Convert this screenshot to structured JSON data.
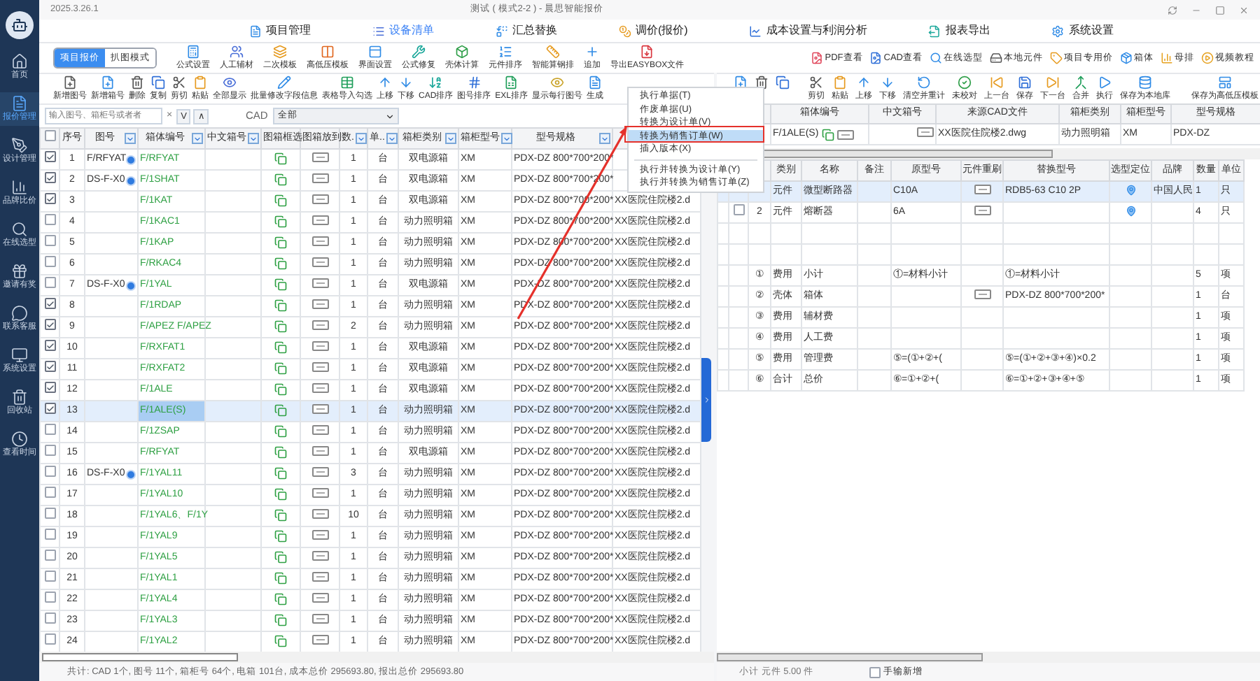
{
  "app": {
    "version": "2025.3.26.1",
    "title": "测试 ( 模式2-2 ) - 晨思智能报价"
  },
  "sidebar": {
    "items": [
      {
        "label": "首页",
        "selected": false
      },
      {
        "label": "报价管理",
        "selected": true
      },
      {
        "label": "设计管理",
        "selected": false
      },
      {
        "label": "品牌比价",
        "selected": false
      },
      {
        "label": "在线选型",
        "selected": false
      },
      {
        "label": "邀请有奖",
        "selected": false
      },
      {
        "label": "联系客服",
        "selected": false
      },
      {
        "label": "系统设置",
        "selected": false
      },
      {
        "label": "回收站",
        "selected": false
      },
      {
        "label": "查看时间",
        "selected": false
      }
    ]
  },
  "main_tabs": [
    {
      "label": "项目管理",
      "selected": false
    },
    {
      "label": "设备清单",
      "selected": true
    },
    {
      "label": "汇总替换",
      "selected": false
    },
    {
      "label": "调价(报价)",
      "selected": false
    },
    {
      "label": "成本设置与利润分析",
      "selected": false
    },
    {
      "label": "报表导出",
      "selected": false
    },
    {
      "label": "系统设置",
      "selected": false
    }
  ],
  "mode_toggle": [
    {
      "label": "项目报价",
      "selected": true
    },
    {
      "label": "扒图模式",
      "selected": false
    }
  ],
  "toolbar_main": [
    "公式设置",
    "人工辅材",
    "二次模板",
    "高低压模板",
    "界面设置",
    "公式修复",
    "壳体计算",
    "元件排序",
    "智能算钢排",
    "追加",
    "导出EASYBOX文件"
  ],
  "toolbar_tools": [
    "PDF查看",
    "CAD查看",
    "在线选型",
    "本地元件",
    "项目专用价",
    "箱体",
    "母排",
    "视频教程"
  ],
  "list_toolbar": [
    "新增图号",
    "新增箱号",
    "删除",
    "复制",
    "剪切",
    "粘贴",
    "全部显示",
    "批量修改字段信息",
    "表格导入勾选",
    "上移",
    "下移",
    "CAD排序",
    "图号排序",
    "EXL排序",
    "显示每行图号",
    "生成"
  ],
  "search": {
    "placeholder": "输入图号、箱柜号或者者",
    "clear": "×",
    "next": "V",
    "prev": "∧",
    "cad_label": "CAD",
    "cad_filter": "全部"
  },
  "list_table": {
    "header_checked": false,
    "columns": [
      {
        "label": "序号",
        "filter": false
      },
      {
        "label": "图号",
        "filter": true
      },
      {
        "label": "箱体编号",
        "filter": true
      },
      {
        "label": "中文箱号",
        "filter": true
      },
      {
        "label": "图箱框选",
        "filter": false
      },
      {
        "label": "图箱放到",
        "filter": false
      },
      {
        "label": "数.",
        "filter": true
      },
      {
        "label": "单..",
        "filter": true
      },
      {
        "label": "箱柜类别",
        "filter": true
      },
      {
        "label": "箱柜型号",
        "filter": true
      },
      {
        "label": "型号规格",
        "filter": true
      }
    ],
    "rows": [
      {
        "checked": true,
        "selected": false,
        "no": "1",
        "drawing": "F/RFYAT",
        "badge": true,
        "box": "F/RFYAT",
        "qty": "1",
        "unit": "台",
        "category": "双电源箱",
        "model": "XM",
        "spec": "PDX-DZ 800*700*200*"
      },
      {
        "checked": true,
        "selected": false,
        "no": "2",
        "drawing": "DS-F-X0",
        "badge": true,
        "box": "F/1SHAT",
        "qty": "1",
        "unit": "台",
        "category": "双电源箱",
        "model": "XM",
        "spec": "PDX-DZ 800*700*200*"
      },
      {
        "checked": true,
        "selected": false,
        "no": "3",
        "box": "F/1KAT",
        "qty": "1",
        "unit": "台",
        "category": "双电源箱",
        "model": "XM",
        "spec": "PDX-DZ 800*700*200*",
        "cad": "XX医院住院楼2.d"
      },
      {
        "checked": false,
        "selected": false,
        "no": "4",
        "box": "F/1KAC1",
        "qty": "1",
        "unit": "台",
        "category": "动力照明箱",
        "model": "XM",
        "spec": "PDX-DZ 800*700*200*",
        "cad": "XX医院住院楼2.d"
      },
      {
        "checked": false,
        "selected": false,
        "no": "5",
        "box": "F/1KAP",
        "qty": "1",
        "unit": "台",
        "category": "动力照明箱",
        "model": "XM",
        "spec": "PDX-DZ 800*700*200*",
        "cad": "XX医院住院楼2.d"
      },
      {
        "checked": false,
        "selected": false,
        "no": "6",
        "box": "F/RKAC4",
        "qty": "1",
        "unit": "台",
        "category": "动力照明箱",
        "model": "XM",
        "spec": "PDX-DZ 800*700*200*",
        "cad": "XX医院住院楼2.d"
      },
      {
        "checked": false,
        "selected": false,
        "no": "7",
        "drawing": "DS-F-X0",
        "badge": true,
        "box": "F/1YAL",
        "qty": "1",
        "unit": "台",
        "category": "双电源箱",
        "model": "XM",
        "spec": "PDX-DZ 800*700*200*",
        "cad": "XX医院住院楼2.d"
      },
      {
        "checked": true,
        "selected": false,
        "no": "8",
        "box": "F/1RDAP",
        "qty": "1",
        "unit": "台",
        "category": "动力照明箱",
        "model": "XM",
        "spec": "PDX-DZ 800*700*200*",
        "cad": "XX医院住院楼2.d"
      },
      {
        "checked": true,
        "selected": false,
        "no": "9",
        "box": "F/APEZ F/APEZ",
        "qty": "2",
        "unit": "台",
        "category": "动力照明箱",
        "model": "XM",
        "spec": "PDX-DZ 800*700*200*",
        "cad": "XX医院住院楼2.d"
      },
      {
        "checked": true,
        "selected": false,
        "no": "10",
        "box": "F/RXFAT1",
        "qty": "1",
        "unit": "台",
        "category": "双电源箱",
        "model": "XM",
        "spec": "PDX-DZ 800*700*200*",
        "cad": "XX医院住院楼2.d"
      },
      {
        "checked": true,
        "selected": false,
        "no": "11",
        "box": "F/RXFAT2",
        "qty": "1",
        "unit": "台",
        "category": "双电源箱",
        "model": "XM",
        "spec": "PDX-DZ 800*700*200*",
        "cad": "XX医院住院楼2.d"
      },
      {
        "checked": true,
        "selected": false,
        "no": "12",
        "box": "F/1ALE",
        "qty": "1",
        "unit": "台",
        "category": "双电源箱",
        "model": "XM",
        "spec": "PDX-DZ 800*700*200*",
        "cad": "XX医院住院楼2.d"
      },
      {
        "checked": true,
        "selected": true,
        "no": "13",
        "box": "F/1ALE(S)",
        "qty": "1",
        "unit": "台",
        "category": "动力照明箱",
        "model": "XM",
        "spec": "PDX-DZ 800*700*200*",
        "cad": "XX医院住院楼2.d"
      },
      {
        "checked": false,
        "selected": false,
        "no": "14",
        "box": "F/1ZSAP",
        "qty": "1",
        "unit": "台",
        "category": "动力照明箱",
        "model": "XM",
        "spec": "PDX-DZ 800*700*200*",
        "cad": "XX医院住院楼2.d"
      },
      {
        "checked": false,
        "selected": false,
        "no": "15",
        "box": "F/RFYAT",
        "qty": "1",
        "unit": "台",
        "category": "双电源箱",
        "model": "XM",
        "spec": "PDX-DZ 800*700*200*",
        "cad": "XX医院住院楼2.d"
      },
      {
        "checked": false,
        "selected": false,
        "no": "16",
        "drawing": "DS-F-X0",
        "badge": true,
        "box": "F/1YAL11",
        "qty": "3",
        "unit": "台",
        "category": "动力照明箱",
        "model": "XM",
        "spec": "PDX-DZ 800*700*200*",
        "cad": "XX医院住院楼2.d"
      },
      {
        "checked": false,
        "selected": false,
        "no": "17",
        "box": "F/1YAL10",
        "qty": "1",
        "unit": "台",
        "category": "动力照明箱",
        "model": "XM",
        "spec": "PDX-DZ 800*700*200*",
        "cad": "XX医院住院楼2.d"
      },
      {
        "checked": false,
        "selected": false,
        "no": "18",
        "box": "F/1YAL6、F/1Y",
        "qty": "10",
        "unit": "台",
        "category": "动力照明箱",
        "model": "XM",
        "spec": "PDX-DZ 800*700*200*",
        "cad": "XX医院住院楼2.d"
      },
      {
        "checked": false,
        "selected": false,
        "no": "19",
        "box": "F/1YAL9",
        "qty": "1",
        "unit": "台",
        "category": "动力照明箱",
        "model": "XM",
        "spec": "PDX-DZ 800*700*200*",
        "cad": "XX医院住院楼2.d"
      },
      {
        "checked": false,
        "selected": false,
        "no": "20",
        "box": "F/1YAL5",
        "qty": "1",
        "unit": "台",
        "category": "动力照明箱",
        "model": "XM",
        "spec": "PDX-DZ 800*700*200*",
        "cad": "XX医院住院楼2.d"
      },
      {
        "checked": false,
        "selected": false,
        "no": "21",
        "box": "F/1YAL1",
        "qty": "1",
        "unit": "台",
        "category": "动力照明箱",
        "model": "XM",
        "spec": "PDX-DZ 800*700*200*",
        "cad": "XX医院住院楼2.d"
      },
      {
        "checked": false,
        "selected": false,
        "no": "22",
        "box": "F/1YAL4",
        "qty": "1",
        "unit": "台",
        "category": "动力照明箱",
        "model": "XM",
        "spec": "PDX-DZ 800*700*200*",
        "cad": "XX医院住院楼2.d"
      },
      {
        "checked": false,
        "selected": false,
        "no": "23",
        "box": "F/1YAL3",
        "qty": "1",
        "unit": "台",
        "category": "动力照明箱",
        "model": "XM",
        "spec": "PDX-DZ 800*700*200*",
        "cad": "XX医院住院楼2.d"
      },
      {
        "checked": false,
        "selected": false,
        "no": "24",
        "box": "F/1YAL2",
        "qty": "1",
        "unit": "台",
        "category": "动力照明箱",
        "model": "XM",
        "spec": "PDX-DZ 800*700*200*",
        "cad": "XX医院住院楼2.d"
      }
    ]
  },
  "list_status": "共计: CAD 1个, 图号 11个, 箱柜号 64个, 电箱 101台, 成本总价 295693.80, 报出总价 295693.80",
  "detail_toolbar": [
    "剪切",
    "粘贴",
    "上移",
    "下移",
    "清空并重计",
    "未校对",
    "上一台",
    "保存",
    "下一台",
    "合并",
    "执行",
    "保存为本地库",
    "保存为高低压模板"
  ],
  "box_header": {
    "columns": [
      "箱体编号",
      "中文箱号",
      "来源CAD文件",
      "箱柜类别",
      "箱柜型号",
      "型号规格"
    ],
    "row": {
      "box": "F/1ALE(S)",
      "cad": "XX医院住院楼2.dwg",
      "category": "动力照明箱",
      "model": "XM",
      "spec": "PDX-DZ"
    }
  },
  "detail_table": {
    "columns": [
      "类别",
      "名称",
      "备注",
      "原型号",
      "元件重刷",
      "替换型号",
      "选型定位",
      "品牌",
      "数量",
      "单位"
    ],
    "rows": [
      {
        "kind": "item",
        "selected": true,
        "category": "元件",
        "name": "微型断路器",
        "orig": "C10A",
        "refresh": true,
        "replace": "RDB5-63 C10 2P",
        "locate": true,
        "brand": "中国人民",
        "qty": "1",
        "unit": "只"
      },
      {
        "kind": "item",
        "selected": false,
        "checked": false,
        "no": "2",
        "category": "元件",
        "name": "熔断器",
        "orig": "6A",
        "refresh": true,
        "locate": true,
        "qty": "4",
        "unit": "只"
      },
      {
        "kind": "blank"
      },
      {
        "kind": "blank"
      },
      {
        "kind": "cost",
        "no": "①",
        "category": "费用",
        "name": "小计",
        "orig": "①=材料小计",
        "replace": "①=材料小计",
        "qty": "5",
        "unit": "项"
      },
      {
        "kind": "cost",
        "no": "②",
        "category": "壳体",
        "name": "箱体",
        "refresh": true,
        "replace": "PDX-DZ 800*700*200*",
        "qty": "1",
        "unit": "台"
      },
      {
        "kind": "cost",
        "no": "③",
        "category": "费用",
        "name": "辅材费",
        "qty": "1",
        "unit": "项"
      },
      {
        "kind": "cost",
        "no": "④",
        "category": "费用",
        "name": "人工费",
        "qty": "1",
        "unit": "项"
      },
      {
        "kind": "cost",
        "no": "⑤",
        "category": "费用",
        "name": "管理费",
        "orig": "⑤=(①+②+(",
        "replace": "⑤=(①+②+③+④)×0.2",
        "qty": "1",
        "unit": "项"
      },
      {
        "kind": "cost",
        "no": "⑥",
        "category": "合计",
        "name": "总价",
        "orig": "⑥=①+②+(",
        "replace": "⑥=①+②+③+④+⑤",
        "qty": "1",
        "unit": "项"
      }
    ]
  },
  "detail_footer": {
    "summary": "小计 元件 5.00 件",
    "manual_add": {
      "label": "手输新增",
      "checked": false
    }
  },
  "context_menu": [
    {
      "label": "执行单据(T)",
      "selected": false,
      "divider_after": false
    },
    {
      "label": "作废单据(U)",
      "selected": false,
      "divider_after": false
    },
    {
      "label": "转换为设计单(V)",
      "selected": false,
      "divider_after": false
    },
    {
      "label": "转换为销售订单(W)",
      "selected": true,
      "divider_after": false
    },
    {
      "label": "插入版本(X)",
      "selected": false,
      "divider_after": true
    },
    {
      "label": "执行并转换为设计单(Y)",
      "selected": false,
      "divider_after": false
    },
    {
      "label": "执行并转换为销售订单(Z)",
      "selected": false,
      "divider_after": false
    }
  ]
}
